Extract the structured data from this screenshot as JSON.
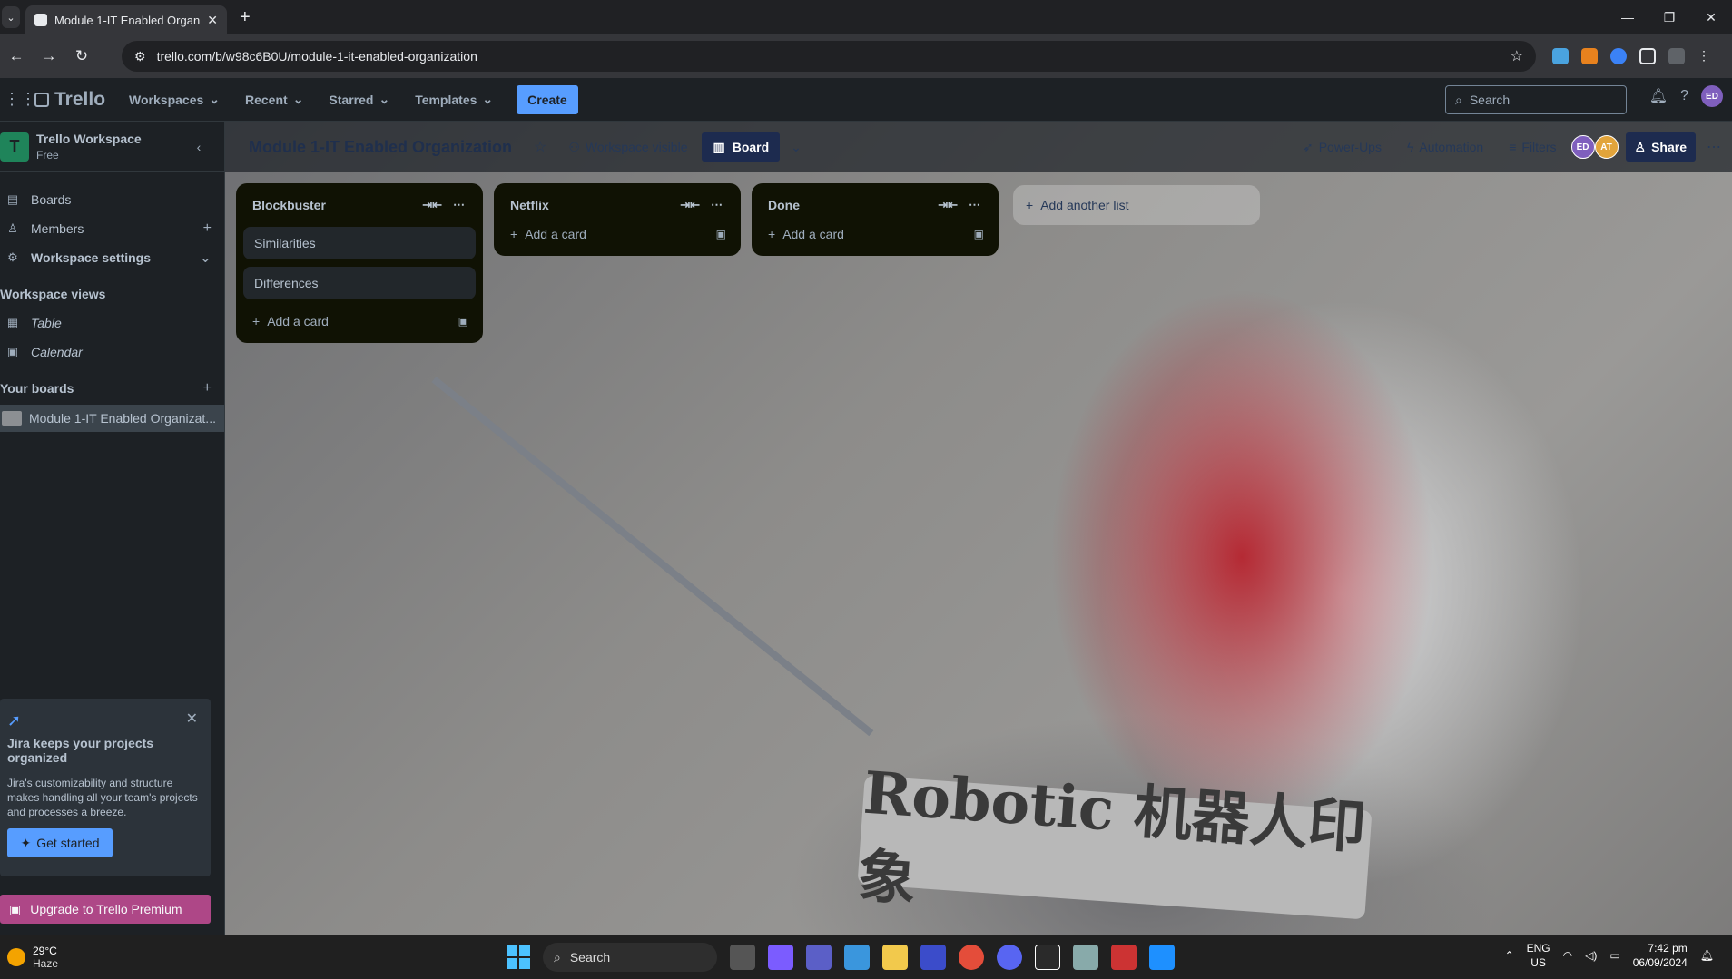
{
  "browser": {
    "tab_title": "Module 1-IT Enabled Organizat",
    "url": "trello.com/b/w98c6B0U/module-1-it-enabled-organization"
  },
  "header": {
    "logo": "Trello",
    "menu": [
      "Workspaces",
      "Recent",
      "Starred",
      "Templates"
    ],
    "create": "Create",
    "search_placeholder": "Search",
    "avatar": "ED"
  },
  "sidebar": {
    "workspace_name": "Trello Workspace",
    "workspace_plan": "Free",
    "items": [
      {
        "label": "Boards",
        "icon": "board-icon"
      },
      {
        "label": "Members",
        "icon": "person-icon"
      },
      {
        "label": "Workspace settings",
        "icon": "gear-icon"
      }
    ],
    "views_heading": "Workspace views",
    "views": [
      {
        "label": "Table",
        "icon": "table-icon"
      },
      {
        "label": "Calendar",
        "icon": "calendar-icon"
      }
    ],
    "boards_heading": "Your boards",
    "boards": [
      {
        "label": "Module 1-IT Enabled Organizat..."
      }
    ],
    "promo": {
      "title": "Jira keeps your projects organized",
      "body": "Jira's customizability and structure makes handling all your team's projects and processes a breeze.",
      "button": "Get started"
    },
    "upgrade": "Upgrade to Trello Premium"
  },
  "board": {
    "title": "Module 1-IT Enabled Organization",
    "visibility": "Workspace visible",
    "view": "Board",
    "powerups": "Power-Ups",
    "automation": "Automation",
    "filters": "Filters",
    "members": [
      "ED",
      "AT"
    ],
    "share": "Share",
    "lists": [
      {
        "name": "Blockbuster",
        "cards": [
          "Similarities",
          "Differences"
        ],
        "add": "Add a card"
      },
      {
        "name": "Netflix",
        "cards": [],
        "add": "Add a card"
      },
      {
        "name": "Done",
        "cards": [],
        "add": "Add a card"
      }
    ],
    "add_list": "Add another list",
    "background_text": "Robotic 机器人印象"
  },
  "taskbar": {
    "temperature": "29°C",
    "condition": "Haze",
    "search": "Search",
    "lang_top": "ENG",
    "lang_bottom": "US",
    "time": "7:42 pm",
    "date": "06/09/2024"
  },
  "colors": {
    "accent": "#579dff",
    "workspace": "#1f845a",
    "upgrade": "#ae4787"
  }
}
